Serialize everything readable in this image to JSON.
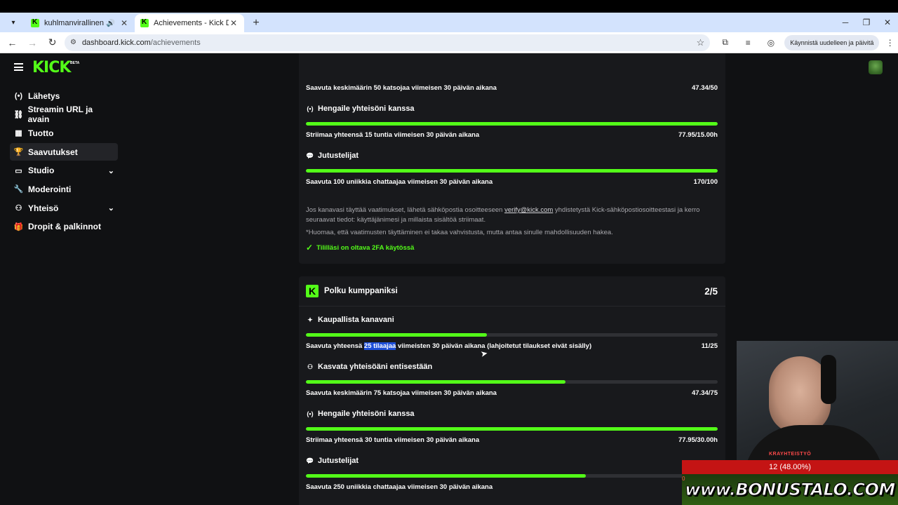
{
  "browser": {
    "tabs": [
      {
        "title": "kuhlmanvirallinen Stream -",
        "active": false,
        "audio": true
      },
      {
        "title": "Achievements - Kick Dashboard",
        "active": true,
        "audio": false
      }
    ],
    "url_host": "dashboard.kick.com",
    "url_path": "/achievements",
    "relaunch_label": "Käynnistä uudelleen ja päivitä"
  },
  "header": {
    "logo": "KICK",
    "logo_badge": "BETA"
  },
  "sidebar": {
    "items": [
      {
        "label": "Lähetys",
        "icon": "broadcast-icon"
      },
      {
        "label": "Streamin URL ja avain",
        "icon": "link-icon"
      },
      {
        "label": "Tuotto",
        "icon": "chart-icon"
      },
      {
        "label": "Saavutukset",
        "icon": "trophy-icon",
        "active": true
      },
      {
        "label": "Studio",
        "icon": "studio-icon",
        "expandable": true
      },
      {
        "label": "Moderointi",
        "icon": "wrench-icon"
      },
      {
        "label": "Yhteisö",
        "icon": "community-icon",
        "expandable": true
      },
      {
        "label": "Dropit & palkinnot",
        "icon": "gift-icon"
      }
    ]
  },
  "card1": {
    "viewers": {
      "label": "Saavuta keskimäärin 50 katsojaa viimeisen 30 päivän aikana",
      "value": "47.34/50"
    },
    "hang": {
      "title": "Hengaile yhteisöni kanssa",
      "label": "Striimaa yhteensä 15 tuntia viimeisen 30 päivän aikana",
      "value": "77.95/15.00h",
      "progress": 1.0
    },
    "chat": {
      "title": "Jutustelijat",
      "label": "Saavuta 100 uniikkia chattaajaa viimeisen 30 päivän aikana",
      "value": "170/100",
      "progress": 1.0
    },
    "info_part1": "Jos kanavasi täyttää vaatimukset, lähetä sähköpostia osoitteeseen",
    "info_email": "verify@kick.com",
    "info_part2": "yhdistetystä Kick-sähköpostiosoitteestasi ja kerro seuraavat tiedot: käyttäjänimesi ja millaista sisältöä striimaat.",
    "note": "*Huomaa, että vaatimusten täyttäminen ei takaa vahvistusta, mutta antaa sinulle mahdollisuuden hakea.",
    "twofa": "Tililläsi on oltava 2FA käytössä"
  },
  "card2": {
    "title": "Polku kumppaniksi",
    "count": "2/5",
    "subs": {
      "title": "Kaupallista kanavani",
      "label_before": "Saavuta yhteensä",
      "label_highlight": "25 tilaajaa",
      "label_after": "viimeisten 30 päivän aikana (lahjoitetut tilaukset eivät sisälly)",
      "value": "11/25",
      "progress": 0.44
    },
    "grow": {
      "title": "Kasvata yhteisöäni entisestään",
      "label": "Saavuta keskimäärin 75 katsojaa viimeisen 30 päivän aikana",
      "value": "47.34/75",
      "progress": 0.631
    },
    "hang": {
      "title": "Hengaile yhteisöni kanssa",
      "label": "Striimaa yhteensä 30 tuntia viimeisen 30 päivän aikana",
      "value": "77.95/30.00h",
      "progress": 1.0
    },
    "chat": {
      "title": "Jutustelijat",
      "label": "Saavuta 250 uniikkia chattaajaa viimeisen 30 päivän aikana",
      "progress": 0.68
    }
  },
  "overlay": {
    "goal_small": "KRAYHTEISTYÖ",
    "goal_value": "12 (48.00%)",
    "goal_zero": "0",
    "brand": "www.BONUSTALO.COM"
  },
  "colors": {
    "accent": "#53fc18",
    "page_bg": "#101113",
    "card_bg": "#18191c"
  }
}
